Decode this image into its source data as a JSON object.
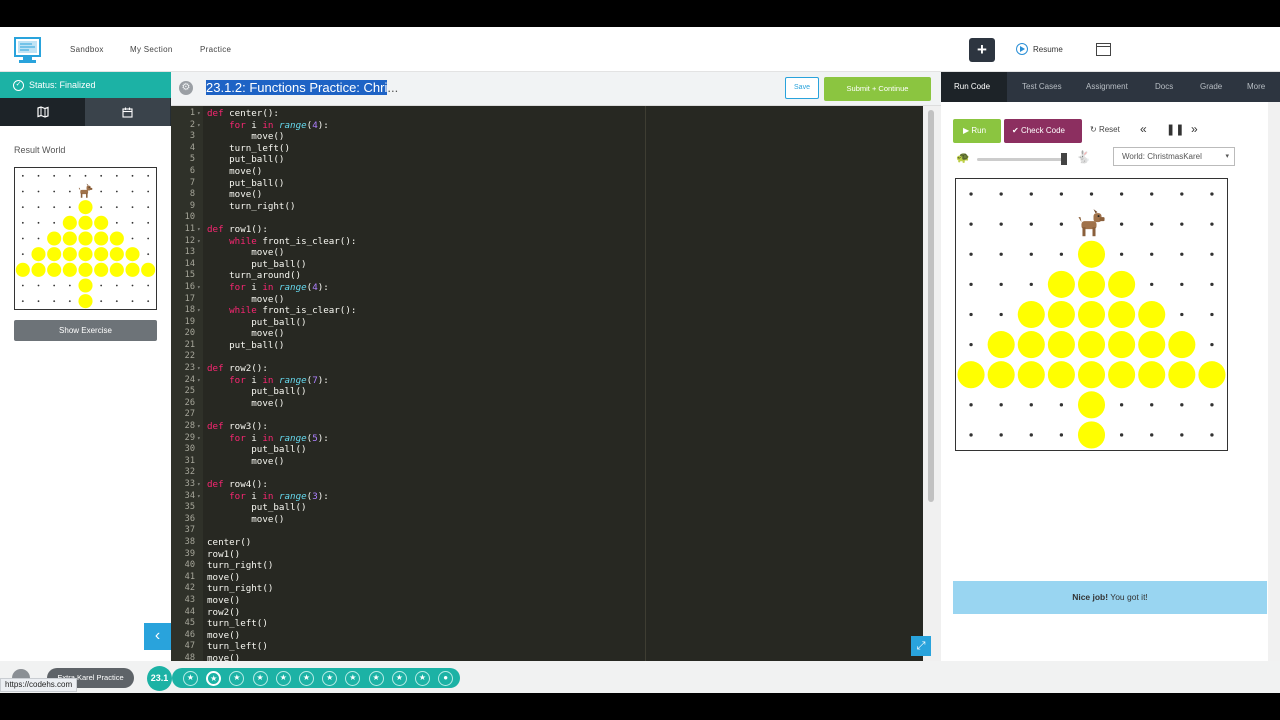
{
  "nav": {
    "links": [
      "Sandbox",
      "My Section",
      "Practice"
    ],
    "plus_label": "+",
    "resume_label": "Resume"
  },
  "left": {
    "status": "Status: Finalized",
    "result_label": "Result World",
    "show_exercise": "Show Exercise"
  },
  "editor": {
    "title_highlight": "23.1.2: Functions Practice: Chri",
    "title_rest": "...",
    "save_label": "Save",
    "submit_label": "Submit + Continue",
    "lines": [
      [
        [
          "kw",
          "def"
        ],
        [
          "t",
          " center():"
        ]
      ],
      [
        [
          "t",
          "    "
        ],
        [
          "kw",
          "for"
        ],
        [
          "t",
          " i "
        ],
        [
          "kw",
          "in"
        ],
        [
          "t",
          " "
        ],
        [
          "bi",
          "range"
        ],
        [
          "t",
          "("
        ],
        [
          "nm",
          "4"
        ],
        [
          "t",
          "):"
        ]
      ],
      [
        [
          "t",
          "        move()"
        ]
      ],
      [
        [
          "t",
          "    turn_left()"
        ]
      ],
      [
        [
          "t",
          "    put_ball()"
        ]
      ],
      [
        [
          "t",
          "    move()"
        ]
      ],
      [
        [
          "t",
          "    put_ball()"
        ]
      ],
      [
        [
          "t",
          "    move()"
        ]
      ],
      [
        [
          "t",
          "    turn_right()"
        ]
      ],
      [],
      [
        [
          "kw",
          "def"
        ],
        [
          "t",
          " row1():"
        ]
      ],
      [
        [
          "t",
          "    "
        ],
        [
          "kw",
          "while"
        ],
        [
          "t",
          " front_is_clear():"
        ]
      ],
      [
        [
          "t",
          "        move()"
        ]
      ],
      [
        [
          "t",
          "        put_ball()"
        ]
      ],
      [
        [
          "t",
          "    turn_around()"
        ]
      ],
      [
        [
          "t",
          "    "
        ],
        [
          "kw",
          "for"
        ],
        [
          "t",
          " i "
        ],
        [
          "kw",
          "in"
        ],
        [
          "t",
          " "
        ],
        [
          "bi",
          "range"
        ],
        [
          "t",
          "("
        ],
        [
          "nm",
          "4"
        ],
        [
          "t",
          "):"
        ]
      ],
      [
        [
          "t",
          "        move()"
        ]
      ],
      [
        [
          "t",
          "    "
        ],
        [
          "kw",
          "while"
        ],
        [
          "t",
          " front_is_clear():"
        ]
      ],
      [
        [
          "t",
          "        put_ball()"
        ]
      ],
      [
        [
          "t",
          "        move()"
        ]
      ],
      [
        [
          "t",
          "    put_ball()"
        ]
      ],
      [],
      [
        [
          "kw",
          "def"
        ],
        [
          "t",
          " row2():"
        ]
      ],
      [
        [
          "t",
          "    "
        ],
        [
          "kw",
          "for"
        ],
        [
          "t",
          " i "
        ],
        [
          "kw",
          "in"
        ],
        [
          "t",
          " "
        ],
        [
          "bi",
          "range"
        ],
        [
          "t",
          "("
        ],
        [
          "nm",
          "7"
        ],
        [
          "t",
          "):"
        ]
      ],
      [
        [
          "t",
          "        put_ball()"
        ]
      ],
      [
        [
          "t",
          "        move()"
        ]
      ],
      [],
      [
        [
          "kw",
          "def"
        ],
        [
          "t",
          " row3():"
        ]
      ],
      [
        [
          "t",
          "    "
        ],
        [
          "kw",
          "for"
        ],
        [
          "t",
          " i "
        ],
        [
          "kw",
          "in"
        ],
        [
          "t",
          " "
        ],
        [
          "bi",
          "range"
        ],
        [
          "t",
          "("
        ],
        [
          "nm",
          "5"
        ],
        [
          "t",
          "):"
        ]
      ],
      [
        [
          "t",
          "        put_ball()"
        ]
      ],
      [
        [
          "t",
          "        move()"
        ]
      ],
      [],
      [
        [
          "kw",
          "def"
        ],
        [
          "t",
          " row4():"
        ]
      ],
      [
        [
          "t",
          "    "
        ],
        [
          "kw",
          "for"
        ],
        [
          "t",
          " i "
        ],
        [
          "kw",
          "in"
        ],
        [
          "t",
          " "
        ],
        [
          "bi",
          "range"
        ],
        [
          "t",
          "("
        ],
        [
          "nm",
          "3"
        ],
        [
          "t",
          "):"
        ]
      ],
      [
        [
          "t",
          "        put_ball()"
        ]
      ],
      [
        [
          "t",
          "        move()"
        ]
      ],
      [],
      [
        [
          "t",
          "center()"
        ]
      ],
      [
        [
          "t",
          "row1()"
        ]
      ],
      [
        [
          "t",
          "turn_right()"
        ]
      ],
      [
        [
          "t",
          "move()"
        ]
      ],
      [
        [
          "t",
          "turn_right()"
        ]
      ],
      [
        [
          "t",
          "move()"
        ]
      ],
      [
        [
          "t",
          "row2()"
        ]
      ],
      [
        [
          "t",
          "turn_left()"
        ]
      ],
      [
        [
          "t",
          "move()"
        ]
      ],
      [
        [
          "t",
          "turn_left()"
        ]
      ],
      [
        [
          "t",
          "move()"
        ]
      ]
    ],
    "fold_lines": [
      1,
      2,
      11,
      12,
      16,
      18,
      23,
      24,
      28,
      29,
      33,
      34
    ]
  },
  "right": {
    "tabs": [
      "Run Code",
      "Test Cases",
      "Assignment",
      "Docs",
      "Grade",
      "More"
    ],
    "run_label": "Run",
    "check_label": "Check Code",
    "reset_label": "Reset",
    "world_select": "World: ChristmasKarel",
    "nice_bold": "Nice job!",
    "nice_rest": " You got it!"
  },
  "world": {
    "cols": 9,
    "rows": 9,
    "karel": [
      4,
      1
    ],
    "balls": [
      [
        4,
        2
      ],
      [
        3,
        3
      ],
      [
        4,
        3
      ],
      [
        5,
        3
      ],
      [
        2,
        4
      ],
      [
        3,
        4
      ],
      [
        4,
        4
      ],
      [
        5,
        4
      ],
      [
        6,
        4
      ],
      [
        1,
        5
      ],
      [
        2,
        5
      ],
      [
        3,
        5
      ],
      [
        4,
        5
      ],
      [
        5,
        5
      ],
      [
        6,
        5
      ],
      [
        7,
        5
      ],
      [
        0,
        6
      ],
      [
        1,
        6
      ],
      [
        2,
        6
      ],
      [
        3,
        6
      ],
      [
        4,
        6
      ],
      [
        5,
        6
      ],
      [
        6,
        6
      ],
      [
        7,
        6
      ],
      [
        8,
        6
      ],
      [
        4,
        7
      ],
      [
        4,
        8
      ]
    ]
  },
  "bottom": {
    "crumb": "Extra Karel Practice",
    "lesson": "23.1",
    "stars": 12,
    "current_star": 1,
    "url": "https://codehs.com"
  },
  "colors": {
    "teal": "#1cb2a5",
    "green": "#8bc540",
    "plum": "#8c2f60",
    "blue": "#29a3dc",
    "ball": "#ffff00",
    "editor_bg": "#272822"
  },
  "icons": {
    "logo": "monitor-logo-icon",
    "status": "check-circle-icon",
    "world_tab": "map-icon",
    "calendar_tab": "calendar-icon",
    "gear": "gear-icon",
    "karel": "dog-icon"
  }
}
